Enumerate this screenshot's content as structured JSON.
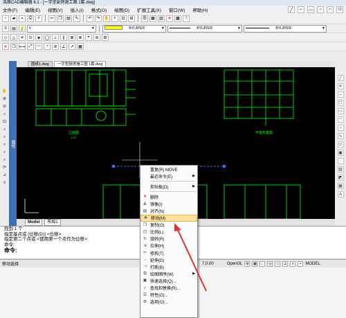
{
  "window_title": "浩辰CAD编辑器 6.1 - [一字型厨房施工图 1套.dwg]",
  "menu": [
    "文件(F)",
    "编辑(E)",
    "视图(V)",
    "插入(I)",
    "格式(O)",
    "绘图(D)",
    "扩展工具(X)",
    "窗口(W)",
    "帮助(H)"
  ],
  "layer_value": "0",
  "color_value": "BYLAYER",
  "linetype_value": "BYLAYER",
  "lineweight_value": "BYLAYER",
  "tabs": [
    "图纸1.dwg",
    "一字型厨房施工图 1套.dwg"
  ],
  "side_panel_label": "属性",
  "layout_tabs": [
    "Model",
    "布局1"
  ],
  "command_lines": [
    "找到 1 个",
    "指定基点或 [位移(D)] <位移>:",
    "指定第二个点或 <使用第一个点作为位移>:",
    "命令:"
  ],
  "command_prompt": "命令:",
  "status": {
    "left": "移动选择",
    "coord": "7,0.00",
    "renderer": "OpenGL",
    "model": "MODEL"
  },
  "drawing": {
    "elevation_label": "立面图",
    "plan_label": "平面布置图",
    "scale_label": "1:30"
  },
  "context_menu": [
    {
      "label": "重复(R) MOVE",
      "icon": "",
      "sub": false
    },
    {
      "label": "最近命令(E)",
      "icon": "",
      "sub": true
    },
    {
      "label": "剪贴板(D)",
      "icon": "",
      "sub": true
    },
    {
      "label": "删除",
      "icon": "✕",
      "sub": false
    },
    {
      "label": "镜像(I)",
      "icon": "◭",
      "sub": false
    },
    {
      "label": "对齐(N)",
      "icon": "▤",
      "sub": false
    },
    {
      "label": "移动(M)",
      "icon": "✥",
      "sub": false,
      "highlight": true
    },
    {
      "label": "复制(O)",
      "icon": "❐",
      "sub": false
    },
    {
      "label": "比例(L)",
      "icon": "◳",
      "sub": false
    },
    {
      "label": "旋转(R)",
      "icon": "↻",
      "sub": false
    },
    {
      "label": "拉伸(H)",
      "icon": "⇲",
      "sub": false
    },
    {
      "label": "修剪(T)",
      "icon": "✂",
      "sub": false
    },
    {
      "label": "延伸(D)",
      "icon": "→",
      "sub": false
    },
    {
      "label": "打断(B)",
      "icon": "⊣",
      "sub": false
    },
    {
      "label": "绘图顺序(W)",
      "icon": "⧉",
      "sub": true
    },
    {
      "label": "快速选择(Q)...",
      "icon": "▣",
      "sub": false
    },
    {
      "label": "查找和替换(R)...",
      "icon": "⌕",
      "sub": false
    },
    {
      "label": "特性(O)...",
      "icon": "☰",
      "sub": false
    },
    {
      "label": "选项(O)...",
      "icon": "⚙",
      "sub": false
    }
  ],
  "colors": {
    "canvas": "#000000",
    "drawing": "#00ff00",
    "accent": "#ffff00",
    "highlight": "#fde49a",
    "arrow": "#e03030"
  }
}
